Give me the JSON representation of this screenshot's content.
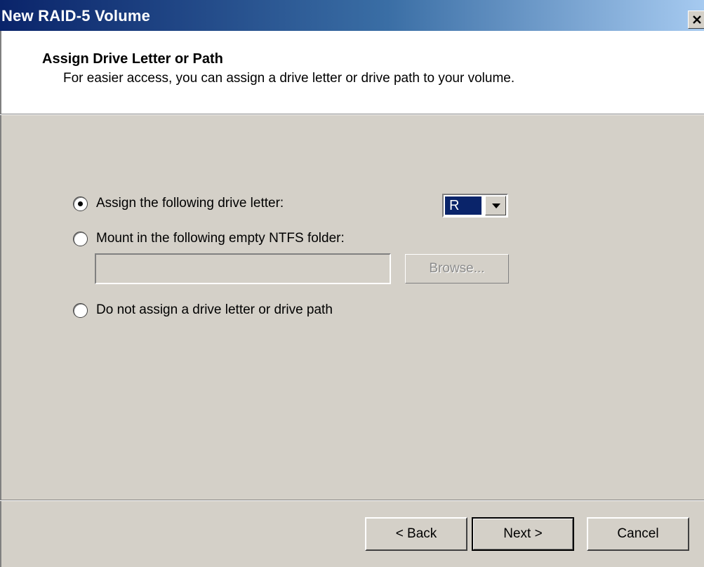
{
  "window": {
    "title": "New RAID-5 Volume",
    "close_icon": "close-icon"
  },
  "header": {
    "title": "Assign Drive Letter or Path",
    "subtitle": "For easier access, you can assign a drive letter or drive path to your volume."
  },
  "options": {
    "assign_letter": {
      "label": "Assign the following drive letter:",
      "checked": true
    },
    "mount_folder": {
      "label": "Mount in the following empty NTFS folder:",
      "checked": false
    },
    "no_assign": {
      "label": "Do not assign a drive letter or drive path",
      "checked": false
    }
  },
  "drive_letter": {
    "selected": "R"
  },
  "folder_path": {
    "value": ""
  },
  "browse_label": "Browse...",
  "buttons": {
    "back": "< Back",
    "next": "Next >",
    "cancel": "Cancel"
  },
  "colors": {
    "title_bar_start": "#0a246a",
    "title_bar_end": "#a6caf0",
    "dialog_bg": "#d4d0c8",
    "selection": "#0a246a"
  }
}
